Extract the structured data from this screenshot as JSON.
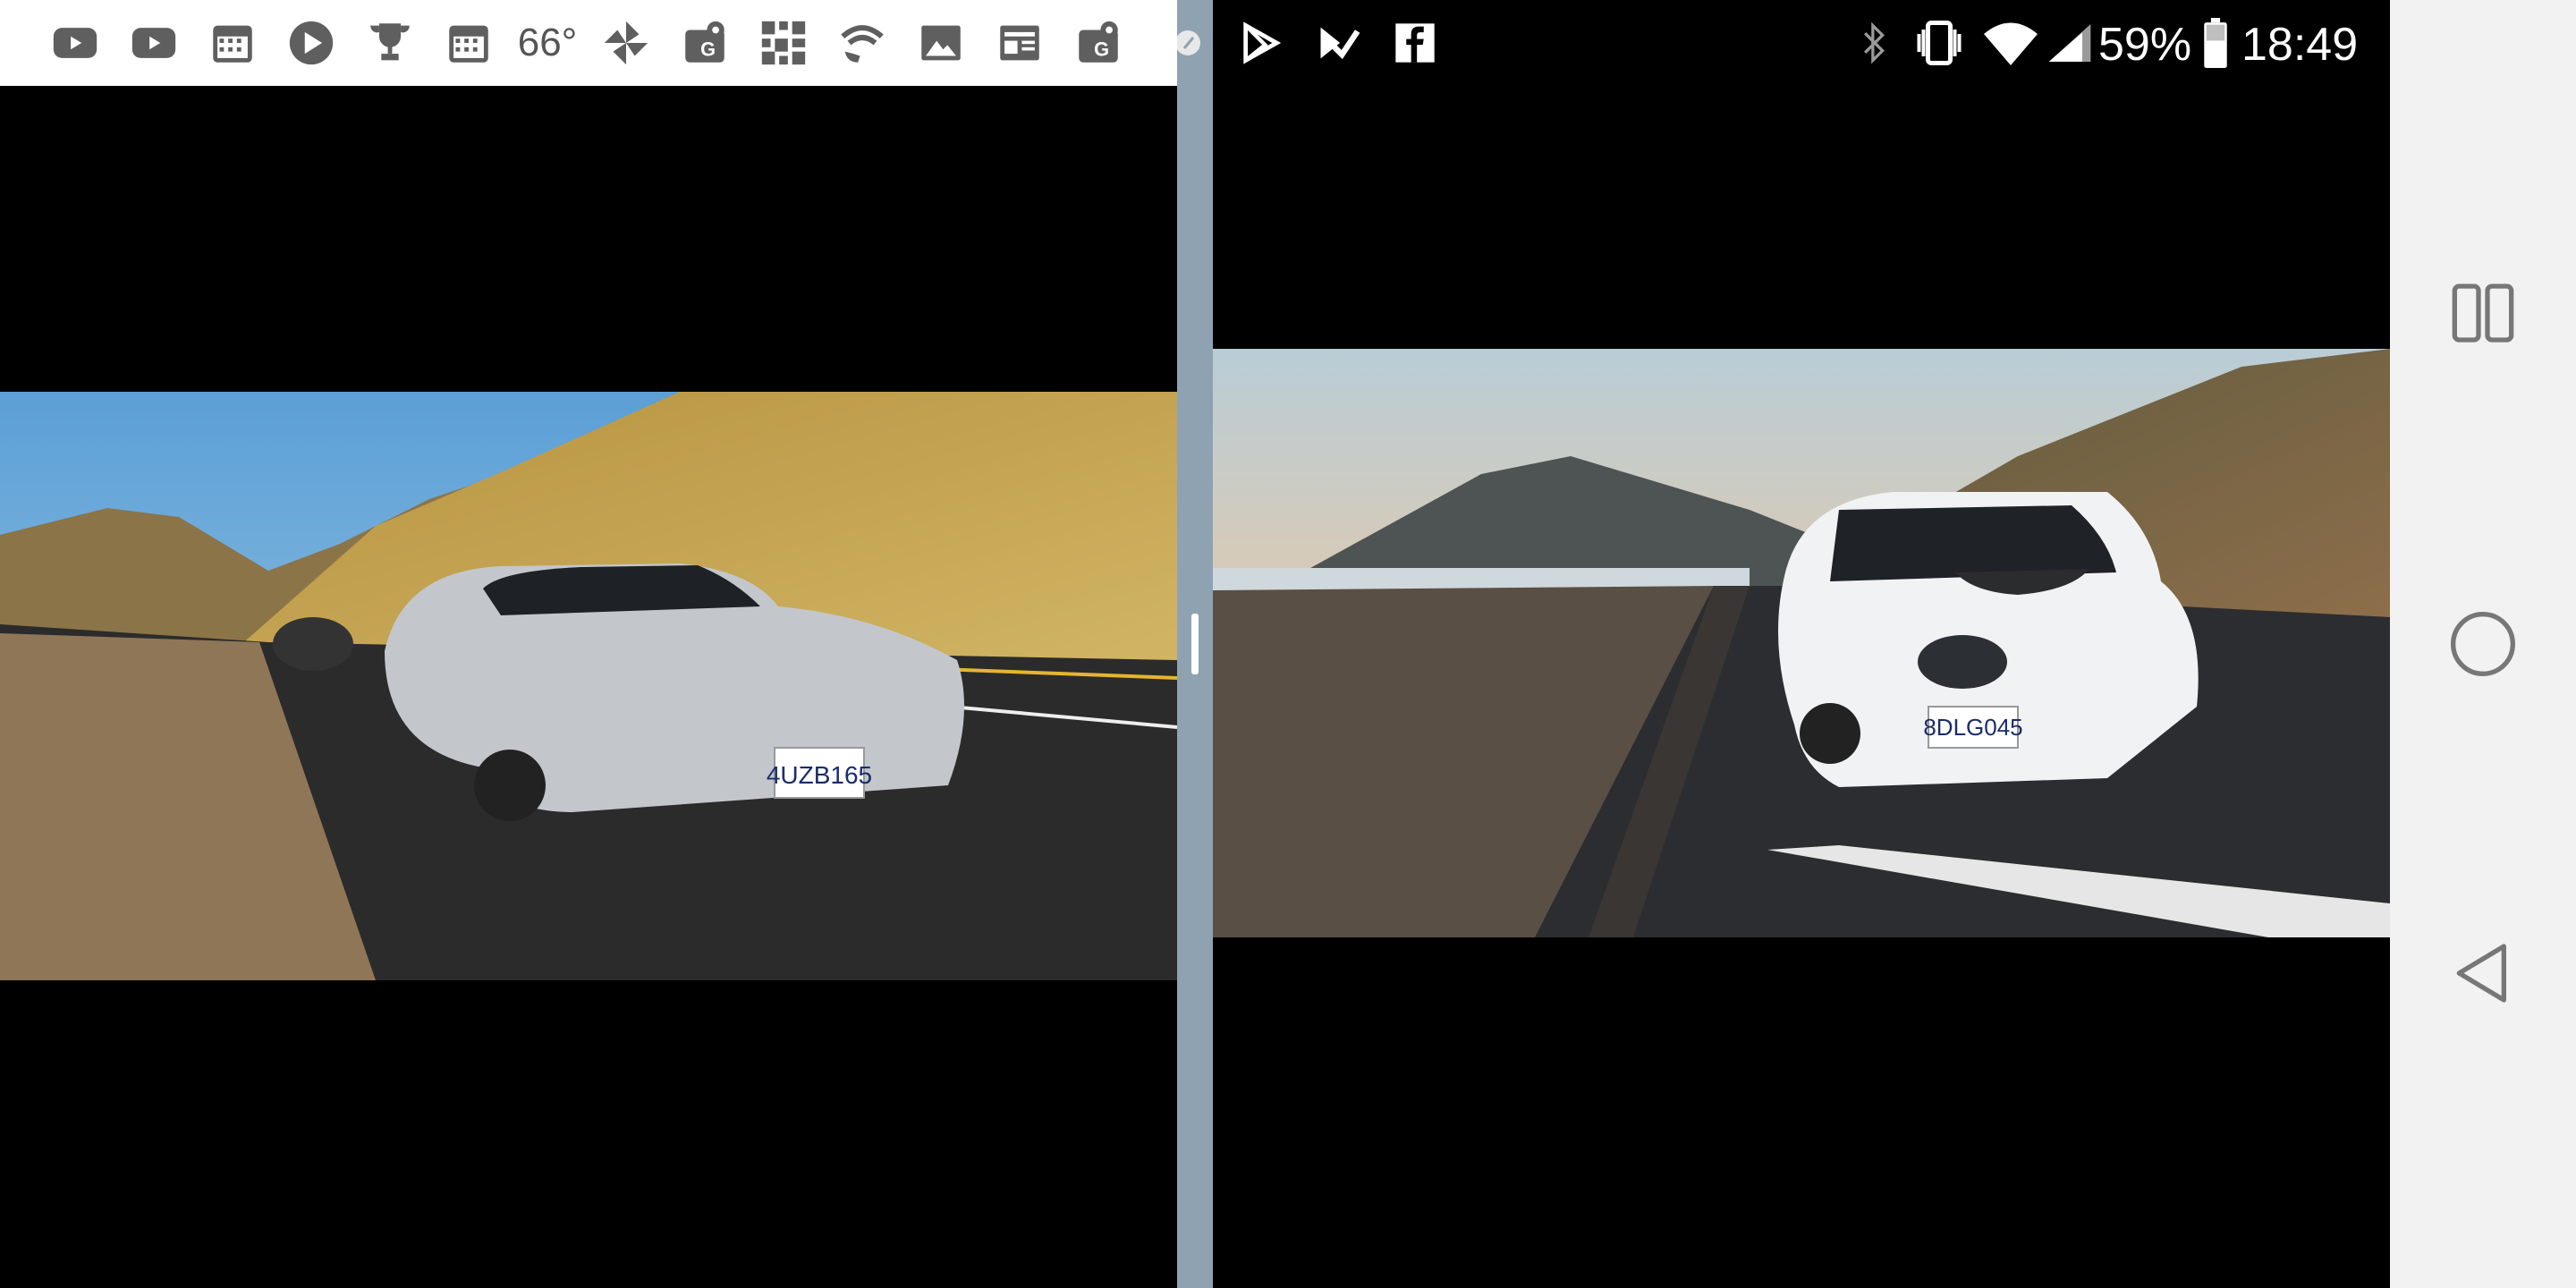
{
  "left_status_bar": {
    "weather_temp": "66°",
    "icons": [
      "youtube-icon",
      "youtube-icon",
      "calendar-icon",
      "play-store-icon",
      "trophy-icon",
      "calendar-icon",
      "weather-text",
      "pinwheel-icon",
      "maps-icon",
      "qr-code-icon",
      "wifi-call-icon",
      "photo-icon",
      "news-icon",
      "maps-icon"
    ]
  },
  "right_status_bar": {
    "left_icons": [
      "play-store-icon",
      "check-list-icon",
      "facebook-icon"
    ],
    "battery_percent": "59%",
    "time": "18:49"
  },
  "photos": {
    "left": {
      "plate": "4UZB165",
      "description": "silver roadster on coastal highway"
    },
    "right": {
      "plate": "8DLG045",
      "description": "white hatchback on coastal highway"
    }
  },
  "nav_bar": {
    "buttons": [
      "split-screen",
      "home",
      "back"
    ]
  },
  "colors": {
    "divider": "#8fa2b2",
    "status_white": "#ffffff",
    "nav_bg": "#f2f2f2"
  }
}
